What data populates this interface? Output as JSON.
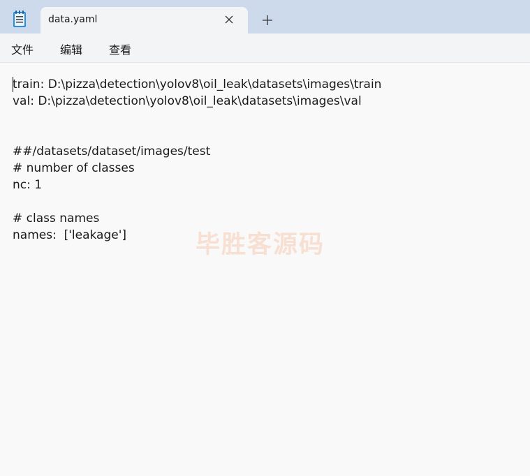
{
  "tab": {
    "title": "data.yaml",
    "close_icon": "close-icon",
    "new_tab_icon": "plus-icon"
  },
  "app_icon": "notepad-icon",
  "menu": {
    "file": "文件",
    "edit": "编辑",
    "view": "查看"
  },
  "editor": {
    "lines": [
      "train: D:\\pizza\\detection\\yolov8\\oil_leak\\datasets\\images\\train",
      "val: D:\\pizza\\detection\\yolov8\\oil_leak\\datasets\\images\\val",
      "",
      "",
      "##/datasets/dataset/images/test",
      "# number of classes",
      "nc: 1",
      "",
      "# class names",
      "names:  ['leakage']"
    ]
  },
  "watermark": "毕胜客源码",
  "colors": {
    "tabbar_bg": "#ccdaeb",
    "tab_bg": "#f3f4f6",
    "editor_bg": "#f9f9f9",
    "watermark": "#f5a06e"
  }
}
